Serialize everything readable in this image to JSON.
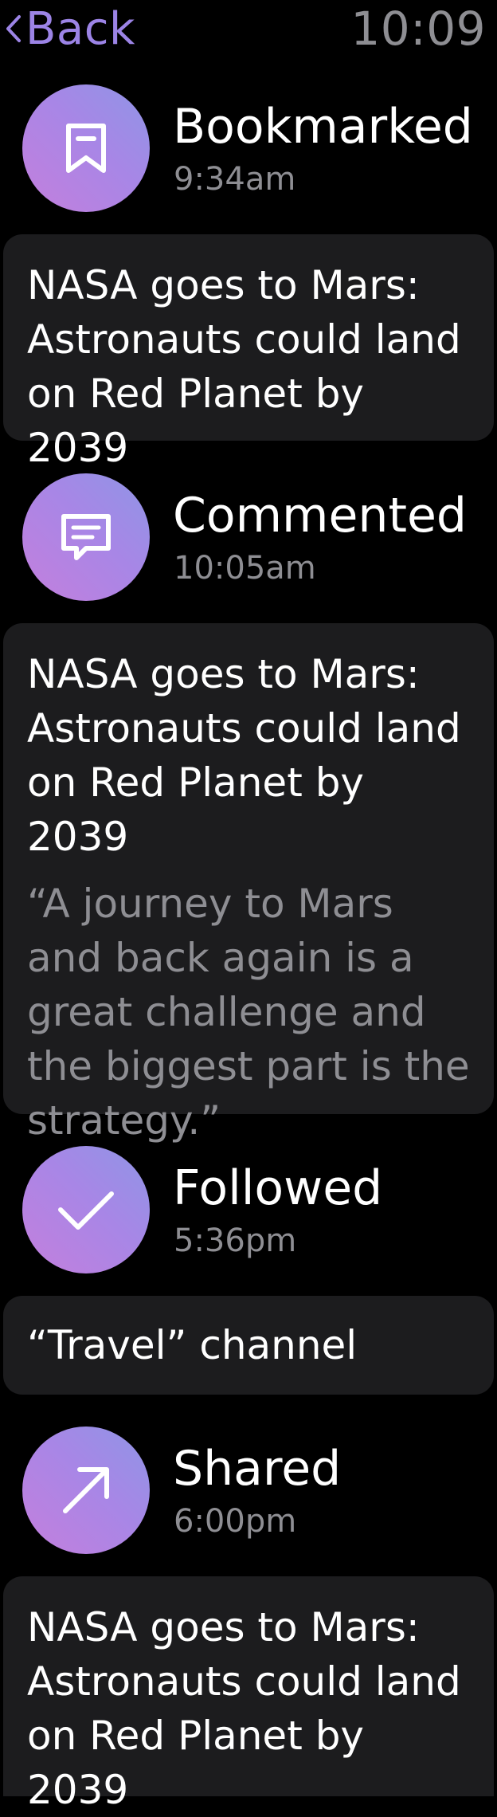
{
  "header": {
    "back_label": "Back",
    "time": "10:09"
  },
  "colors": {
    "accent": "#9c84e6",
    "icon_gradient_start": "#8f95e6",
    "icon_gradient_end": "#c47fdd",
    "card_background": "#1c1c1e",
    "secondary_text": "#8e8e93"
  },
  "activities": [
    {
      "icon": "bookmark-icon",
      "title": "Bookmarked",
      "time": "9:34am",
      "card": {
        "headline": "NASA goes to Mars: Astronauts could land on Red Planet by 2039"
      }
    },
    {
      "icon": "comment-icon",
      "title": "Commented",
      "time": "10:05am",
      "card": {
        "headline": "NASA goes to Mars: Astronauts could land on Red Planet by 2039",
        "quote": "“A journey to Mars and back again is a great challenge and the biggest part is the strategy.”"
      }
    },
    {
      "icon": "checkmark-icon",
      "title": "Followed",
      "time": "5:36pm",
      "card": {
        "headline": "“Travel” channel"
      }
    },
    {
      "icon": "share-arrow-icon",
      "title": "Shared",
      "time": "6:00pm",
      "card": {
        "headline": "NASA goes to Mars: Astronauts could land on Red Planet by 2039"
      }
    }
  ]
}
